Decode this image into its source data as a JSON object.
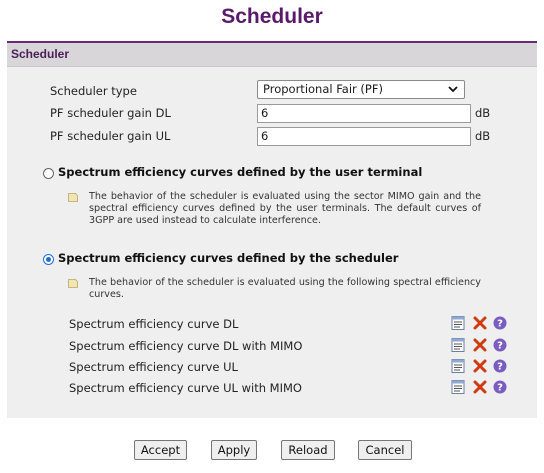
{
  "page": {
    "title": "Scheduler"
  },
  "panel": {
    "header": "Scheduler",
    "fields": {
      "scheduler_type_label": "Scheduler type",
      "scheduler_type_value": "Proportional Fair (PF)",
      "gain_dl_label": "PF scheduler gain DL",
      "gain_dl_value": "6",
      "gain_dl_unit": "dB",
      "gain_ul_label": "PF scheduler gain UL",
      "gain_ul_value": "6",
      "gain_ul_unit": "dB"
    },
    "option_user": {
      "label": "Spectrum efficiency curves defined by the user terminal",
      "selected": false,
      "description": "The behavior of the scheduler is evaluated using the sector MIMO gain and the spectral efficiency curves defined by the user terminals. The default curves of 3GPP are used instead to calculate interference."
    },
    "option_scheduler": {
      "label": "Spectrum efficiency curves defined by the scheduler",
      "selected": true,
      "description": "The behavior of the scheduler is evaluated using the following spectral efficiency curves."
    },
    "curves": [
      {
        "label": "Spectrum efficiency curve DL"
      },
      {
        "label": "Spectrum efficiency curve DL with MIMO"
      },
      {
        "label": "Spectrum efficiency curve UL"
      },
      {
        "label": "Spectrum efficiency curve UL with MIMO"
      }
    ],
    "curve_icons": [
      "edit-list-icon",
      "delete-icon",
      "help-icon"
    ]
  },
  "buttons": {
    "accept": "Accept",
    "apply": "Apply",
    "reload": "Reload",
    "cancel": "Cancel"
  },
  "colors": {
    "accent": "#5a1a6b",
    "radio_selected": "#1f6fd1",
    "delete": "#d03a10",
    "help": "#7a5cc0"
  }
}
